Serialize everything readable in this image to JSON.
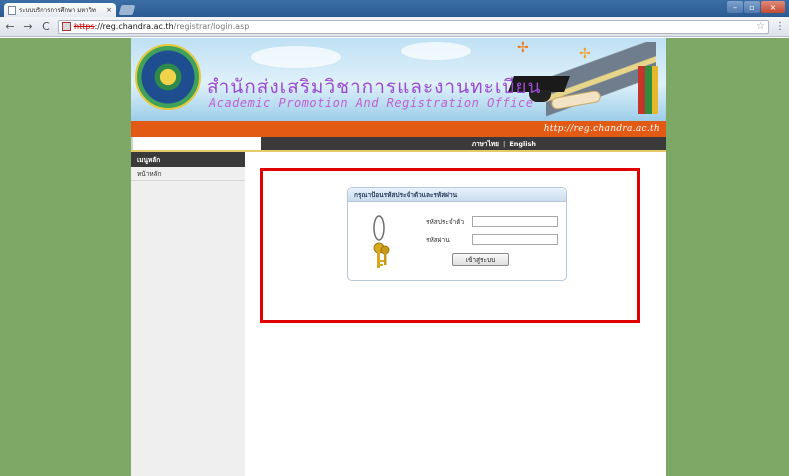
{
  "browser": {
    "tab_title": "ระบบบริการการศึกษา มหาวิท",
    "tab_close": "×",
    "url_scheme": "https",
    "url_host": "://reg.chandra.ac.th",
    "url_path": "/registrar/login.asp",
    "back": "←",
    "forward": "→",
    "reload": "C"
  },
  "banner": {
    "title_thai": "สำนักส่งเสริมวิชาการและงานทะเบียน",
    "title_english": "Academic Promotion And Registration Office",
    "url": "http://reg.chandra.ac.th"
  },
  "language_bar": {
    "thai": "ภาษาไทย",
    "separator": "|",
    "english": "English"
  },
  "sidebar": {
    "header": "เมนูหลัก",
    "items": [
      {
        "label": "หน้าหลัก"
      }
    ]
  },
  "login": {
    "heading": "กรุณาป้อนรหัสประจำตัวและรหัสผ่าน",
    "user_label": "รหัสประจำตัว",
    "user_value": "",
    "password_label": "รหัสผ่าน",
    "password_value": "",
    "submit_label": "เข้าสู่ระบบ"
  },
  "colors": {
    "page_background": "#7da866",
    "orange_bar": "#e35a14",
    "highlight": "#e00000"
  }
}
